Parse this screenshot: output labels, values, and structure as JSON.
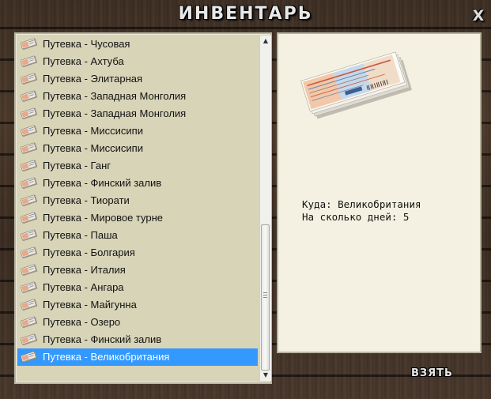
{
  "window": {
    "title": "ИНВЕНТАРЬ",
    "close_label": "X"
  },
  "list": {
    "item_icon": "ticket-icon",
    "items": [
      {
        "label": "Путевка - Чусовая"
      },
      {
        "label": "Путевка - Ахтуба"
      },
      {
        "label": "Путевка - Элитарная"
      },
      {
        "label": "Путевка - Западная Монголия"
      },
      {
        "label": "Путевка - Западная Монголия"
      },
      {
        "label": "Путевка - Миссисипи"
      },
      {
        "label": "Путевка - Миссисипи"
      },
      {
        "label": "Путевка - Ганг"
      },
      {
        "label": "Путевка - Финский залив"
      },
      {
        "label": "Путевка - Тиорати"
      },
      {
        "label": "Путевка - Мировое турне"
      },
      {
        "label": "Путевка - Паша"
      },
      {
        "label": "Путевка - Болгария"
      },
      {
        "label": "Путевка - Италия"
      },
      {
        "label": "Путевка - Ангара"
      },
      {
        "label": "Путевка - Майгунна"
      },
      {
        "label": "Путевка - Озеро"
      },
      {
        "label": "Путевка - Финский залив"
      },
      {
        "label": "Путевка - Великобритания",
        "selected": true
      }
    ],
    "selection_color": "#3399ff"
  },
  "detail": {
    "image": "ticket-stack-image",
    "destination_label": "Куда: Великобритания",
    "days_label": "На сколько дней: 5"
  },
  "actions": {
    "take_label": "ВЗЯТЬ"
  }
}
